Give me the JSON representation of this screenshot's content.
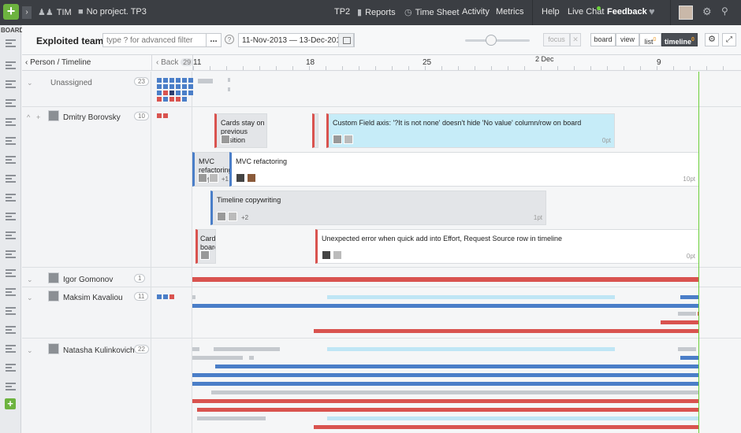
{
  "topbar": {
    "team": "TIM",
    "project": "No project. TP3",
    "nav": [
      "TP2",
      "Reports",
      "Time Sheet",
      "Activity",
      "Metrics"
    ],
    "help": "Help",
    "live_chat": "Live Chat",
    "feedback": "Feedback"
  },
  "rail": {
    "label": "BOARD"
  },
  "toolbar": {
    "title": "Exploited team",
    "search_placeholder": "type ? for advanced filter",
    "dots": "...",
    "help": "?",
    "date_range": "11-Nov-2013 — 13-Dec-2013",
    "zoom": 0.41,
    "focus": "focus",
    "focus_close": "✕",
    "views": [
      "board",
      "view",
      "list",
      "timeline"
    ],
    "list_badge": "0",
    "timeline_badge": "0",
    "active_view": "timeline"
  },
  "header": {
    "person_label": "Person / Timeline",
    "back_label": "Back",
    "back_count": "29",
    "month": "2 Dec",
    "dates": [
      "11",
      "18",
      "25",
      "9"
    ]
  },
  "people": [
    {
      "name": "Unassigned",
      "count": "23"
    },
    {
      "name": "Dmitry Borovsky",
      "count": "10"
    },
    {
      "name": "Igor Gomonov",
      "count": "1"
    },
    {
      "name": "Maksim Kavaliou",
      "count": "11"
    },
    {
      "name": "Natasha Kulinkovich",
      "count": "22"
    }
  ],
  "cards": [
    {
      "title": "Cards stay on previous position",
      "points": ""
    },
    {
      "title": "Custom Field axis: '?It is not none' doesn't hide 'No value' column/row on board",
      "points": "0pt"
    },
    {
      "title": "MVC refactoring steps)",
      "extra": "+1",
      "points": ""
    },
    {
      "title": "MVC refactoring",
      "points": "10pt"
    },
    {
      "title": "Timeline copywriting",
      "extra": "+2",
      "points": "1pt"
    },
    {
      "title": "Cards board",
      "points": ""
    },
    {
      "title": "Unexpected error when quick add into Effort, Request Source row in timeline",
      "points": "0pt"
    }
  ],
  "colors": {
    "red": "#d9534f",
    "blue": "#4a7ec8",
    "grey": "#c5c9ce",
    "lightblue": "#bfe6f5",
    "now": "#6ccf3b",
    "add": "#6db33f"
  }
}
